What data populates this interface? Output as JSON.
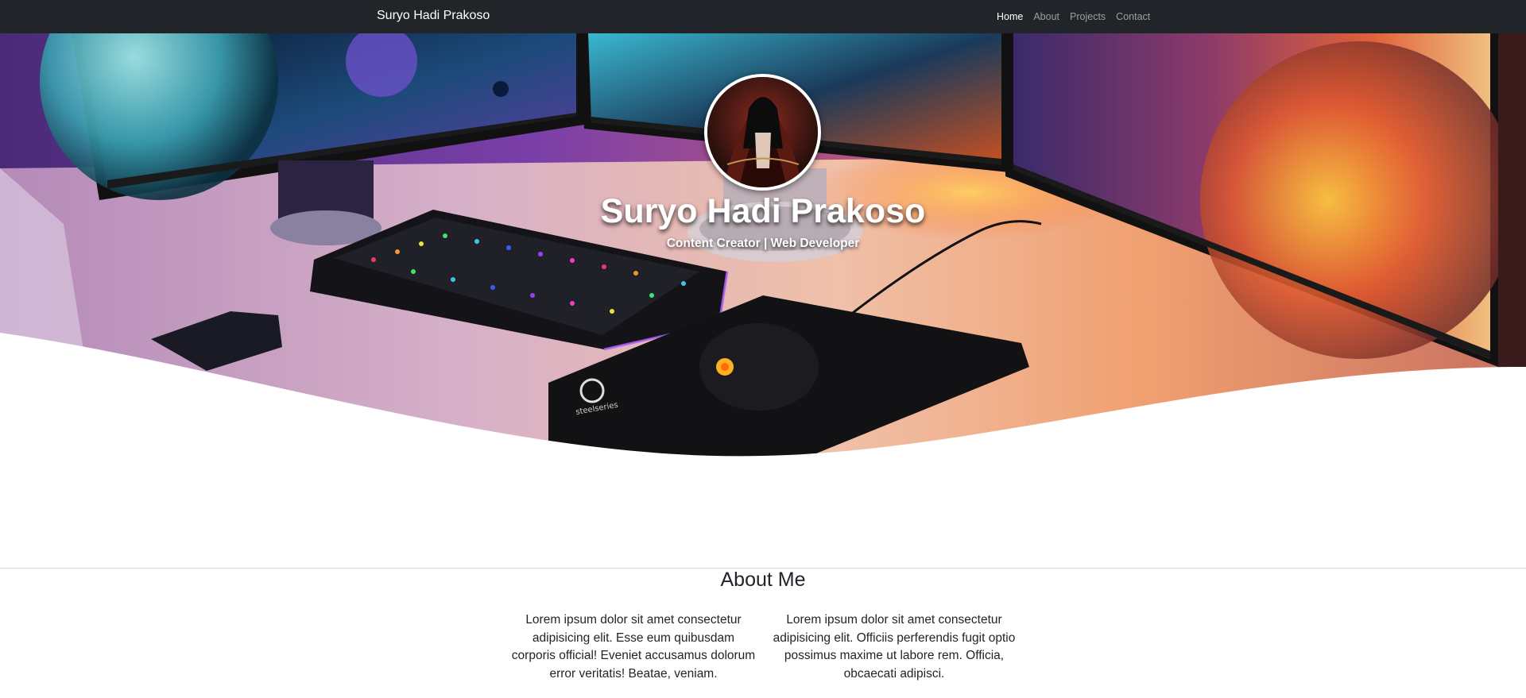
{
  "navbar": {
    "brand": "Suryo Hadi Prakoso",
    "links": [
      {
        "label": "Home",
        "active": true
      },
      {
        "label": "About",
        "active": false
      },
      {
        "label": "Projects",
        "active": false
      },
      {
        "label": "Contact",
        "active": false
      }
    ]
  },
  "hero": {
    "title": "Suryo Hadi Prakoso",
    "subtitle": "Content Creator | Web Developer",
    "mouse_logo_text": "steelseries"
  },
  "about": {
    "title": "About Me",
    "paragraphs": [
      "Lorem ipsum dolor sit amet consectetur adipisicing elit. Esse eum quibusdam corporis official! Eveniet accusamus dolorum error veritatis! Beatae, veniam.",
      "Lorem ipsum dolor sit amet consectetur adipisicing elit. Officiis perferendis fugit optio possimus maxime ut labore rem. Officia, obcaecati adipisci."
    ]
  },
  "colors": {
    "navbar_bg": "#212529",
    "nav_active": "#ffffff",
    "nav_inactive": "#9a9da0",
    "page_bg": "#ffffff",
    "text": "#212529"
  }
}
